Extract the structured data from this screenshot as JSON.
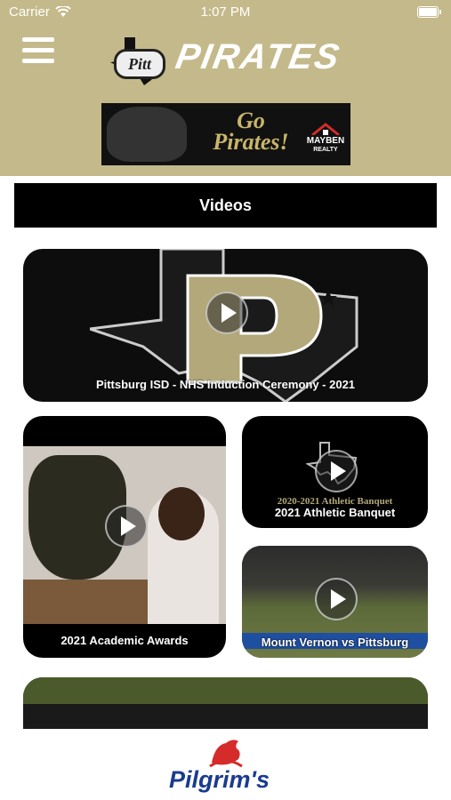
{
  "status_bar": {
    "carrier": "Carrier",
    "time": "1:07 PM"
  },
  "header": {
    "brand_badge": "Pitt",
    "brand_title": "PIRATES",
    "background_color": "#c4b98a"
  },
  "ad_banner": {
    "slogan_line1": "Go",
    "slogan_line2": "Pirates!",
    "sponsor_name": "MAYBEN",
    "sponsor_sub": "REALTY"
  },
  "page": {
    "title": "Videos"
  },
  "videos": [
    {
      "title": "Pittsburg ISD - NHS Induction Ceremony - 2021"
    },
    {
      "title": "2021 Academic Awards"
    },
    {
      "title": "2021 Athletic Banquet",
      "thumb_text": "2020-2021 Athletic Banquet"
    },
    {
      "title": "Mount Vernon vs Pittsburg"
    },
    {
      "title": ""
    }
  ],
  "footer": {
    "sponsor": "Pilgrim's"
  }
}
